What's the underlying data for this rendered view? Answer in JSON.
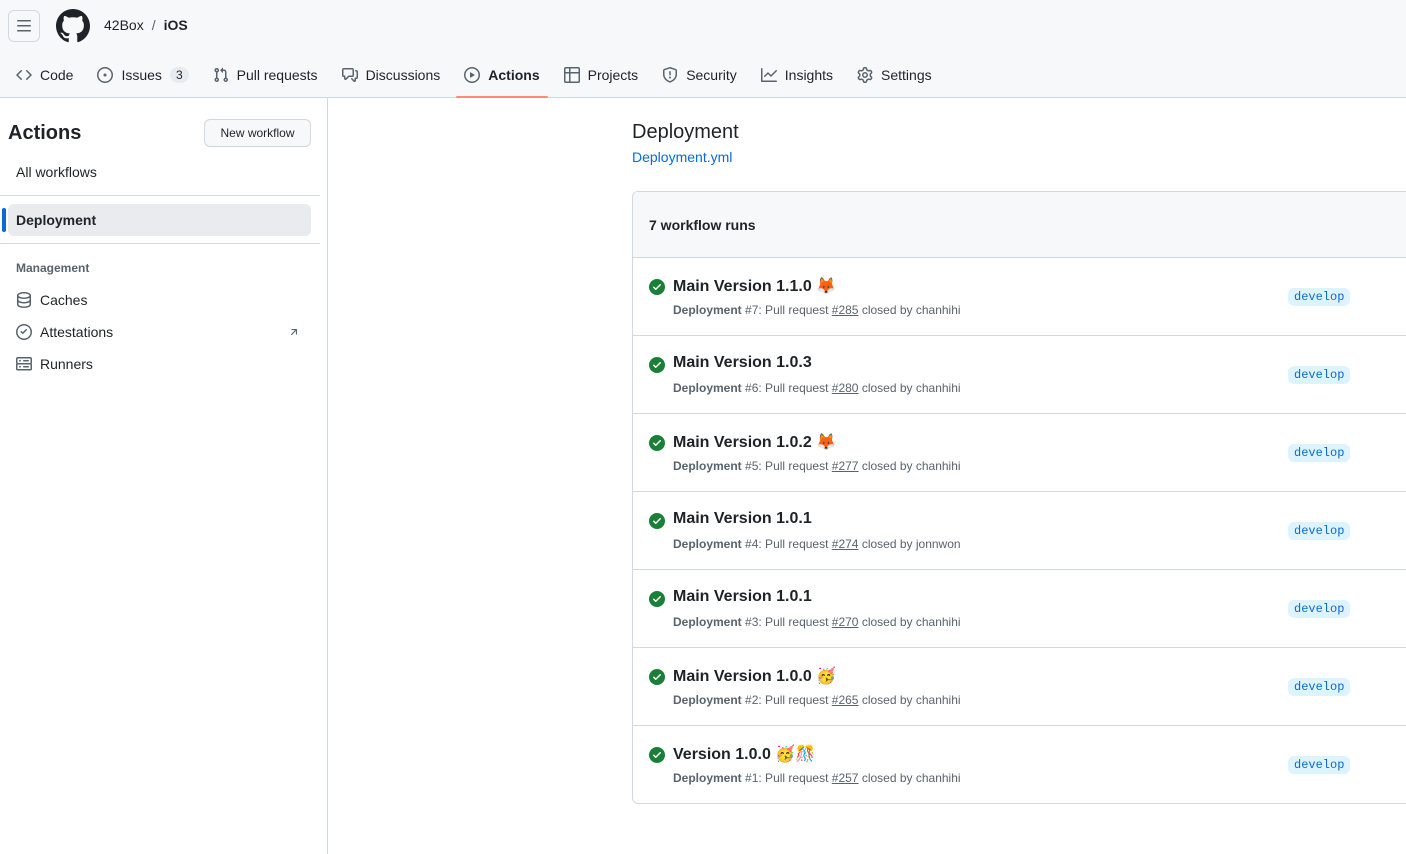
{
  "header": {
    "owner": "42Box",
    "separator": "/",
    "repo": "iOS"
  },
  "nav": [
    {
      "label": "Code",
      "icon": "code-icon"
    },
    {
      "label": "Issues",
      "icon": "issue-opened-icon",
      "count": "3"
    },
    {
      "label": "Pull requests",
      "icon": "git-pull-request-icon"
    },
    {
      "label": "Discussions",
      "icon": "comment-discussion-icon"
    },
    {
      "label": "Actions",
      "icon": "play-icon",
      "active": true
    },
    {
      "label": "Projects",
      "icon": "table-icon"
    },
    {
      "label": "Security",
      "icon": "shield-icon"
    },
    {
      "label": "Insights",
      "icon": "graph-icon"
    },
    {
      "label": "Settings",
      "icon": "gear-icon"
    }
  ],
  "sidebar": {
    "title": "Actions",
    "new_workflow_label": "New workflow",
    "all_workflows": "All workflows",
    "selected_workflow": "Deployment",
    "management_heading": "Management",
    "management_items": [
      {
        "label": "Caches",
        "icon": "database-icon"
      },
      {
        "label": "Attestations",
        "icon": "verified-icon"
      },
      {
        "label": "Runners",
        "icon": "server-icon"
      }
    ]
  },
  "main": {
    "title": "Deployment",
    "file": "Deployment.yml",
    "runs_count_label": "7 workflow runs",
    "runs": [
      {
        "title": "Main Version 1.1.0 🦊",
        "workflow": "Deployment",
        "run": "#7",
        "event": ": Pull request",
        "pr": "#285",
        "closed_by": "closed by chanhihi",
        "branch": "develop"
      },
      {
        "title": "Main Version 1.0.3",
        "workflow": "Deployment",
        "run": "#6",
        "event": ": Pull request",
        "pr": "#280",
        "closed_by": "closed by chanhihi",
        "branch": "develop"
      },
      {
        "title": "Main Version 1.0.2 🦊",
        "workflow": "Deployment",
        "run": "#5",
        "event": ": Pull request",
        "pr": "#277",
        "closed_by": "closed by chanhihi",
        "branch": "develop"
      },
      {
        "title": "Main Version 1.0.1",
        "workflow": "Deployment",
        "run": "#4",
        "event": ": Pull request",
        "pr": "#274",
        "closed_by": "closed by jonnwon",
        "branch": "develop"
      },
      {
        "title": "Main Version 1.0.1",
        "workflow": "Deployment",
        "run": "#3",
        "event": ": Pull request",
        "pr": "#270",
        "closed_by": "closed by chanhihi",
        "branch": "develop"
      },
      {
        "title": "Main Version 1.0.0 🥳",
        "workflow": "Deployment",
        "run": "#2",
        "event": ": Pull request",
        "pr": "#265",
        "closed_by": "closed by chanhihi",
        "branch": "develop"
      },
      {
        "title": "Version 1.0.0 🥳🎊",
        "workflow": "Deployment",
        "run": "#1",
        "event": ": Pull request",
        "pr": "#257",
        "closed_by": "closed by chanhihi",
        "branch": "develop"
      }
    ]
  },
  "colors": {
    "accent": "#0969da",
    "success": "#1a7f37",
    "active_underline": "#fd8c73",
    "border": "#d1d9e0"
  }
}
